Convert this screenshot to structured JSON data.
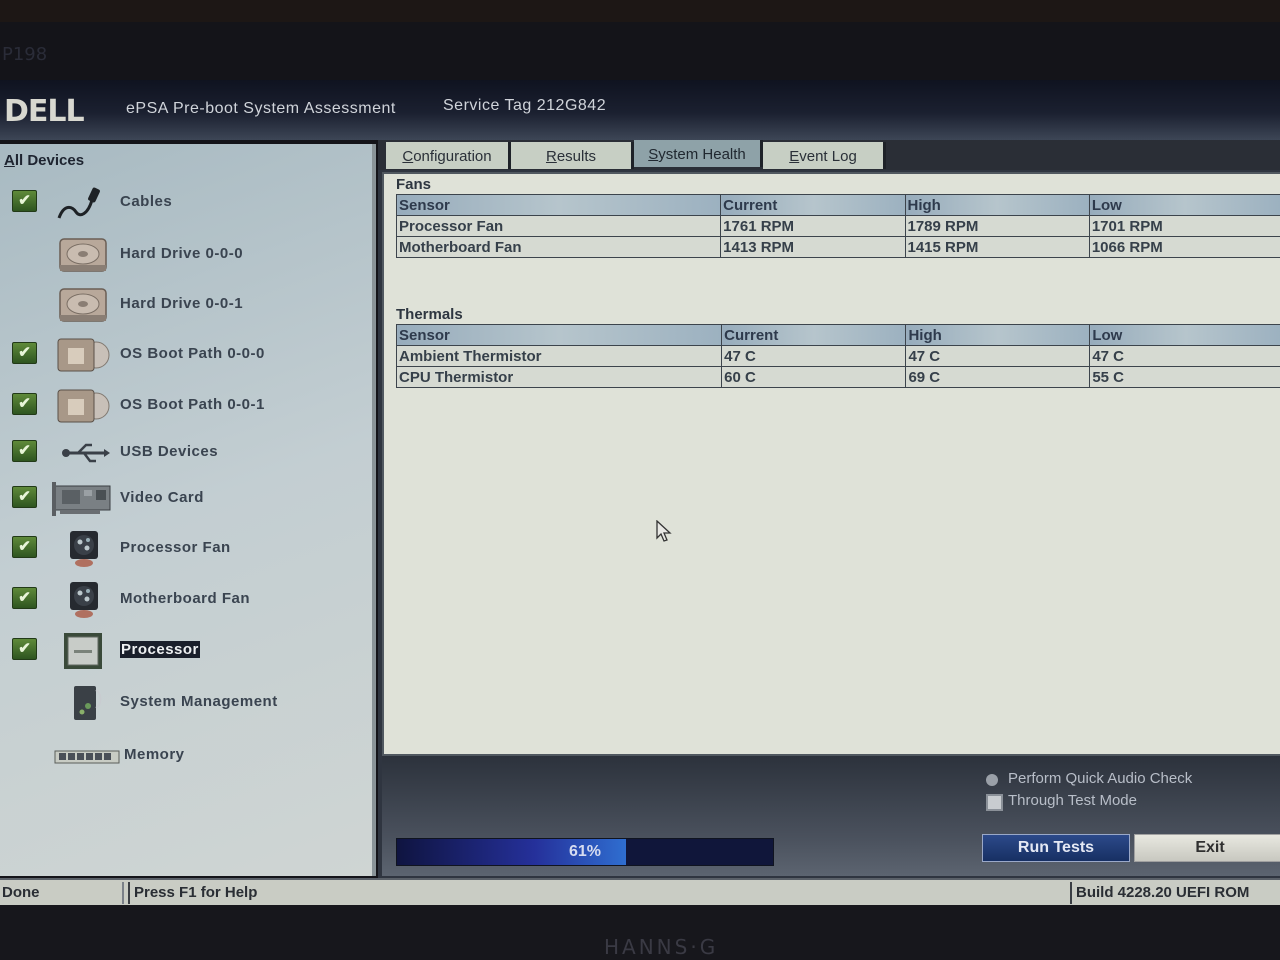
{
  "bezel": {
    "model_label": "P198",
    "brand": "HANNS·G"
  },
  "header": {
    "logo": "DELL",
    "title": "ePSA Pre-boot System Assessment",
    "service_tag": "Service Tag 212G842"
  },
  "sidebar": {
    "header_first": "A",
    "header_rest": "ll Devices",
    "items": [
      {
        "label": "Cables",
        "checked": true,
        "icon": "cable-icon"
      },
      {
        "label": "Hard Drive 0-0-0",
        "checked": false,
        "icon": "hard-drive-icon"
      },
      {
        "label": "Hard Drive 0-0-1",
        "checked": false,
        "icon": "hard-drive-icon"
      },
      {
        "label": "OS Boot Path 0-0-0",
        "checked": true,
        "icon": "boot-path-icon"
      },
      {
        "label": "OS Boot Path 0-0-1",
        "checked": true,
        "icon": "boot-path-icon"
      },
      {
        "label": "USB Devices",
        "checked": true,
        "icon": "usb-icon"
      },
      {
        "label": "Video Card",
        "checked": true,
        "icon": "video-card-icon"
      },
      {
        "label": "Processor Fan",
        "checked": true,
        "icon": "fan-icon"
      },
      {
        "label": "Motherboard Fan",
        "checked": true,
        "icon": "fan-icon"
      },
      {
        "label": "Processor",
        "checked": true,
        "icon": "processor-icon",
        "selected": true
      },
      {
        "label": "System Management",
        "checked": false,
        "icon": "system-management-icon"
      },
      {
        "label": "Memory",
        "checked": false,
        "icon": "memory-icon"
      }
    ],
    "check_glyph": "✔"
  },
  "tabs": [
    {
      "first": "C",
      "rest": "onfiguration",
      "active": false
    },
    {
      "first": "R",
      "rest": "esults",
      "active": false
    },
    {
      "first": "S",
      "rest": "ystem Health",
      "active": true
    },
    {
      "first": "E",
      "rest": "vent Log",
      "active": false
    }
  ],
  "fans": {
    "title": "Fans",
    "columns": [
      "Sensor",
      "Current",
      "High",
      "Low"
    ],
    "rows": [
      [
        "Processor Fan",
        "1761 RPM",
        "1789 RPM",
        "1701 RPM"
      ],
      [
        "Motherboard Fan",
        "1413 RPM",
        "1415 RPM",
        "1066 RPM"
      ]
    ]
  },
  "thermals": {
    "title": "Thermals",
    "columns": [
      "Sensor",
      "Current",
      "High",
      "Low"
    ],
    "rows": [
      [
        "Ambient Thermistor",
        "47 C",
        "47 C",
        "47 C"
      ],
      [
        "CPU Thermistor",
        "60 C",
        "69 C",
        "55 C"
      ]
    ]
  },
  "options": {
    "audio_check": "Perform Quick Audio Check",
    "thorough_mode": "Through Test Mode"
  },
  "progress": {
    "percent": 61,
    "label": "61%"
  },
  "buttons": {
    "run": "Run Tests",
    "exit": "Exit"
  },
  "status": {
    "state": "Done",
    "help": "Press F1 for Help",
    "build": "Build  4228.20 UEFI ROM"
  },
  "colors": {
    "selected_bg": "#1a1f2b",
    "check_green": "#4b7a30",
    "active_tab": "#8ea2a8",
    "progress_blue": "#25309a"
  }
}
